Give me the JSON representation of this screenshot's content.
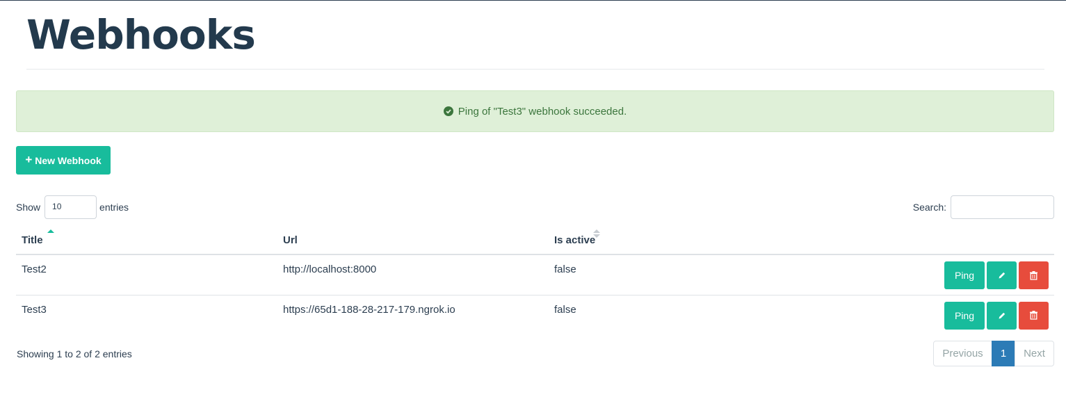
{
  "page": {
    "title": "Webhooks"
  },
  "alert": {
    "message": "Ping of \"Test3\" webhook succeeded.",
    "icon": "check-circle-icon",
    "color": "#3c763d"
  },
  "toolbar": {
    "new_label": "New Webhook",
    "new_icon": "plus-icon",
    "accent": "#18bc9c"
  },
  "length": {
    "show_label": "Show",
    "value": "10",
    "entries_label": "entries"
  },
  "search": {
    "label": "Search:",
    "value": ""
  },
  "table": {
    "columns": [
      {
        "label": "Title",
        "sort": "ascending"
      },
      {
        "label": "Url",
        "sort": "none"
      },
      {
        "label": "Is active",
        "sort": "sortable"
      }
    ],
    "rows": [
      {
        "title": "Test2",
        "url": "http://localhost:8000",
        "is_active": "false",
        "ping_label": "Ping"
      },
      {
        "title": "Test3",
        "url": "https://65d1-188-28-217-179.ngrok.io",
        "is_active": "false",
        "ping_label": "Ping"
      }
    ]
  },
  "footer": {
    "info": "Showing 1 to 2 of 2 entries",
    "prev_label": "Previous",
    "current_page": "1",
    "next_label": "Next"
  },
  "colors": {
    "primary": "#18bc9c",
    "danger": "#e74c3c",
    "heading": "#233a4d",
    "page_active": "#2c7bb6"
  }
}
